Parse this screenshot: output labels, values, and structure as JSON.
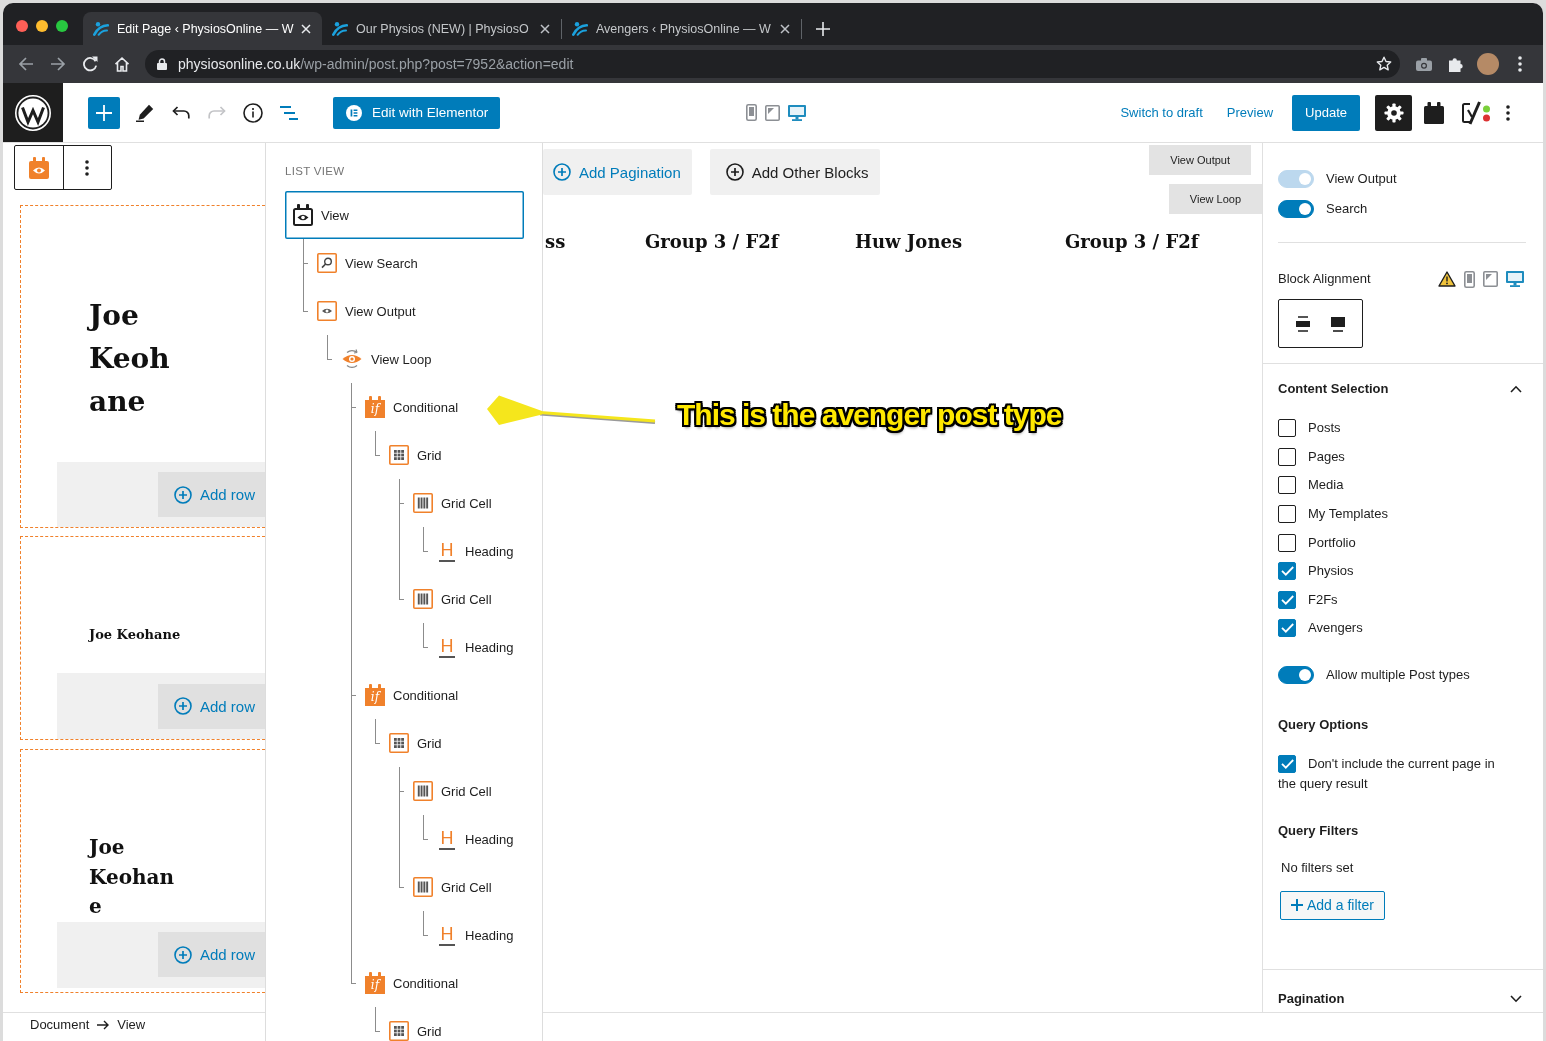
{
  "browser": {
    "tabs": [
      {
        "title": "Edit Page ‹ PhysiosOnline — W",
        "selected": true
      },
      {
        "title": "Our Physios (NEW) | PhysiosO",
        "selected": false
      },
      {
        "title": "Avengers ‹ PhysiosOnline — W",
        "selected": false
      }
    ],
    "url": {
      "host": "physiosonline.co.uk",
      "path": "/wp-admin/post.php?post=7952&action=edit"
    }
  },
  "header": {
    "toolbar": [
      {
        "kind": "add",
        "on": false,
        "disabled": false
      },
      {
        "kind": "tools",
        "on": false,
        "disabled": false
      },
      {
        "kind": "undo",
        "on": false,
        "disabled": false
      },
      {
        "kind": "redo",
        "on": false,
        "disabled": true
      },
      {
        "kind": "info",
        "on": false,
        "disabled": false
      },
      {
        "kind": "outline",
        "on": true,
        "disabled": false
      }
    ],
    "elementor_button": "Edit with Elementor",
    "devices": [
      {
        "kind": "mobile",
        "selected": false
      },
      {
        "kind": "tablet",
        "selected": false
      },
      {
        "kind": "desktop",
        "selected": true
      }
    ],
    "switch_to_draft": "Switch to draft",
    "preview": "Preview",
    "update": "Update",
    "settings": {
      "on": true
    }
  },
  "canvas": {
    "blocks": [
      {
        "kind": "large",
        "heading": "Joe Keohane",
        "add_row": "Add row"
      },
      {
        "kind": "small",
        "heading": "Joe Keohane",
        "add_row": "Add row"
      },
      {
        "kind": "medium",
        "heading": "Joe Keohane",
        "add_row": "Add row"
      }
    ],
    "buttons": [
      {
        "kind": "primary",
        "label": "Add Pagination"
      },
      {
        "kind": "secondary",
        "label": "Add Other Blocks"
      }
    ],
    "block_labels": [
      "View Output",
      "View Loop"
    ],
    "headings": [
      "ss",
      "Group 3 / F2f",
      "Huw Jones",
      "Group 3 / F2f"
    ]
  },
  "list_view": {
    "title": "LIST VIEW",
    "items": [
      {
        "kind": "view",
        "label": "View",
        "selected": true,
        "children": [
          {
            "kind": "search",
            "label": "View Search",
            "selected": false
          },
          {
            "kind": "output",
            "label": "View Output",
            "selected": false,
            "children": [
              {
                "kind": "loop",
                "label": "View Loop",
                "selected": false,
                "children": [
                  {
                    "kind": "conditional",
                    "glyph": "if",
                    "label": "Conditional",
                    "selected": false,
                    "children": [
                      {
                        "kind": "grid",
                        "label": "Grid",
                        "selected": false,
                        "children": [
                          {
                            "kind": "cell",
                            "label": "Grid Cell",
                            "selected": false,
                            "children": [
                              {
                                "kind": "heading",
                                "glyph": "H",
                                "label": "Heading",
                                "selected": false
                              }
                            ]
                          },
                          {
                            "kind": "cell",
                            "label": "Grid Cell",
                            "selected": false,
                            "children": [
                              {
                                "kind": "heading",
                                "glyph": "H",
                                "label": "Heading",
                                "selected": false
                              }
                            ]
                          }
                        ]
                      }
                    ]
                  },
                  {
                    "kind": "conditional",
                    "glyph": "if",
                    "label": "Conditional",
                    "selected": false,
                    "children": [
                      {
                        "kind": "grid",
                        "label": "Grid",
                        "selected": false,
                        "children": [
                          {
                            "kind": "cell",
                            "label": "Grid Cell",
                            "selected": false,
                            "children": [
                              {
                                "kind": "heading",
                                "glyph": "H",
                                "label": "Heading",
                                "selected": false
                              }
                            ]
                          },
                          {
                            "kind": "cell",
                            "label": "Grid Cell",
                            "selected": false,
                            "children": [
                              {
                                "kind": "heading",
                                "glyph": "H",
                                "label": "Heading",
                                "selected": false
                              }
                            ]
                          }
                        ]
                      }
                    ]
                  },
                  {
                    "kind": "conditional",
                    "glyph": "if",
                    "label": "Conditional",
                    "selected": false,
                    "children": [
                      {
                        "kind": "grid",
                        "label": "Grid",
                        "selected": false
                      }
                    ]
                  }
                ]
              }
            ]
          }
        ]
      }
    ]
  },
  "annotation": {
    "text": "This is the avenger post type"
  },
  "sidebar": {
    "view_elements": [
      {
        "label": "View Output",
        "on": true,
        "disabled": true
      },
      {
        "label": "Search",
        "on": true,
        "disabled": false
      }
    ],
    "block_alignment": {
      "label": "Block Alignment",
      "devices": [
        {
          "kind": "mobile",
          "selected": false
        },
        {
          "kind": "tablet",
          "selected": false
        },
        {
          "kind": "desktop",
          "selected": true
        }
      ]
    },
    "content_selection": {
      "title": "Content Selection",
      "expanded": true,
      "post_types": [
        {
          "label": "Posts",
          "checked": false
        },
        {
          "label": "Pages",
          "checked": false
        },
        {
          "label": "Media",
          "checked": false
        },
        {
          "label": "My Templates",
          "checked": false
        },
        {
          "label": "Portfolio",
          "checked": false
        },
        {
          "label": "Physios",
          "checked": true
        },
        {
          "label": "F2Fs",
          "checked": true
        },
        {
          "label": "Avengers",
          "checked": true
        }
      ],
      "allow_multiple": {
        "label": "Allow multiple Post types",
        "on": true
      },
      "query_options": {
        "title": "Query Options",
        "options": [
          {
            "label": "Don't include the current page in the query result",
            "checked": true
          }
        ]
      },
      "query_filters": {
        "title": "Query Filters",
        "empty_text": "No filters set",
        "button": "Add a filter"
      }
    },
    "pagination": {
      "title": "Pagination",
      "expanded": false
    }
  },
  "breadcrumbs": [
    "Document",
    "View"
  ]
}
